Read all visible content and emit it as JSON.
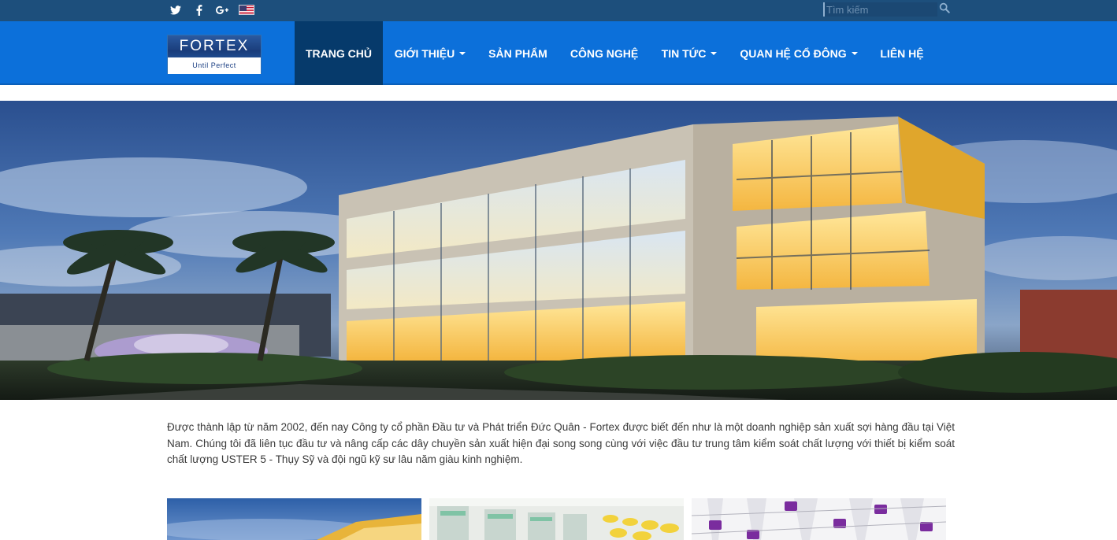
{
  "topbar": {
    "social": [
      {
        "icon": "twitter-icon"
      },
      {
        "icon": "facebook-icon"
      },
      {
        "icon": "google-plus-icon"
      }
    ],
    "language_flag": "us-flag-icon",
    "search_placeholder": "Tìm kiếm",
    "search_icon": "search-icon"
  },
  "logo": {
    "brand": "FORTEX",
    "tagline": "Until Perfect"
  },
  "nav": {
    "items": [
      {
        "label": "TRANG CHỦ",
        "active": true,
        "dropdown": false
      },
      {
        "label": "GIỚI THIỆU",
        "active": false,
        "dropdown": true
      },
      {
        "label": "SẢN PHẨM",
        "active": false,
        "dropdown": false
      },
      {
        "label": "CÔNG NGHỆ",
        "active": false,
        "dropdown": false
      },
      {
        "label": "TIN TỨC",
        "active": false,
        "dropdown": true
      },
      {
        "label": "QUAN HỆ CỔ ĐÔNG",
        "active": false,
        "dropdown": true
      },
      {
        "label": "LIÊN HỆ",
        "active": false,
        "dropdown": false
      }
    ]
  },
  "intro": {
    "text": "Được thành lập từ năm 2002, đến nay Công ty cổ phần Đầu tư và Phát triển Đức Quân - Fortex được biết đến như là một doanh nghiệp sản xuất sợi hàng đầu tại Việt Nam. Chúng tôi đã liên tục đầu tư và nâng cấp các dây chuyền sản xuất hiện đại song song cùng với việc đầu tư trung tâm kiểm soát chất lượng với thiết bị kiểm soát chất lượng USTER 5 - Thụy Sỹ và đội ngũ kỹ sư lâu năm giàu kinh nghiệm."
  },
  "colors": {
    "topbar": "#1d4f7c",
    "navbar": "#0c70da",
    "nav_active": "#063a6b",
    "text": "#3a3a3a"
  }
}
